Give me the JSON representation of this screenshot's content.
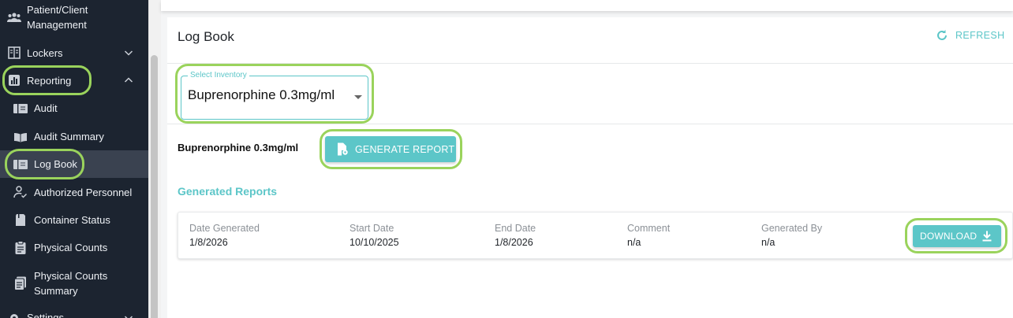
{
  "sidebar": {
    "items": [
      {
        "label_line1": "Patient/Client",
        "label_line2": "Management",
        "icon": "people-icon"
      },
      {
        "label": "Lockers",
        "icon": "locker-icon",
        "chevron": "down"
      },
      {
        "label": "Reporting",
        "icon": "chart-icon",
        "chevron": "up"
      },
      {
        "label": "Audit",
        "icon": "book-icon"
      },
      {
        "label": "Audit Summary",
        "icon": "open-book-icon"
      },
      {
        "label": "Log Book",
        "icon": "book-icon",
        "active": true
      },
      {
        "label": "Authorized Personnel",
        "icon": "person-check-icon"
      },
      {
        "label": "Container Status",
        "icon": "container-icon"
      },
      {
        "label": "Physical Counts",
        "icon": "clipboard-icon"
      },
      {
        "label_line1": "Physical Counts",
        "label_line2": "Summary",
        "icon": "clipboard-list-icon"
      },
      {
        "label": "Settings",
        "icon": "gear-icon",
        "chevron": "down"
      }
    ]
  },
  "main": {
    "title": "Log Book",
    "refresh_label": "REFRESH",
    "select": {
      "legend": "Select Inventory",
      "value": "Buprenorphine 0.3mg/ml"
    },
    "selected_name": "Buprenorphine 0.3mg/ml",
    "generate_label": "GENERATE REPORT",
    "section_title": "Generated Reports",
    "report": {
      "columns": [
        "Date Generated",
        "Start Date",
        "End Date",
        "Comment",
        "Generated By"
      ],
      "values": [
        "1/8/2026",
        "10/10/2025",
        "1/8/2026",
        "n/a",
        "n/a"
      ],
      "download_label": "DOWNLOAD"
    }
  },
  "colors": {
    "accent": "#5cc6c8",
    "sidebar_bg": "#1c2430",
    "highlight": "#9ad35c"
  }
}
